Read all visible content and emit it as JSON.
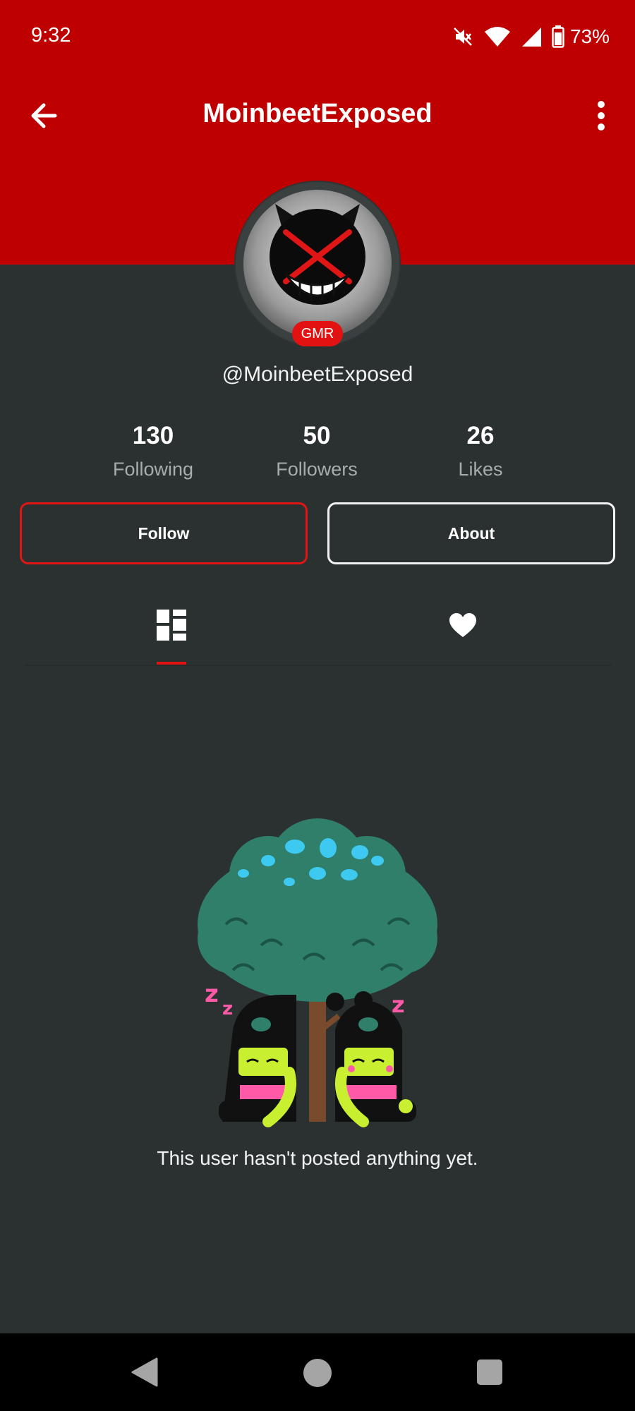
{
  "status_bar": {
    "time": "9:32",
    "battery_percent": "73%",
    "icons": [
      "mute-icon",
      "wifi-icon",
      "signal-icon",
      "battery-icon"
    ]
  },
  "toolbar": {
    "title": "MoinbeetExposed",
    "back_icon": "arrow-left-icon",
    "menu_icon": "more-vertical-icon"
  },
  "profile": {
    "badge": "GMR",
    "username": "@MoinbeetExposed"
  },
  "stats": [
    {
      "value": "130",
      "label": "Following"
    },
    {
      "value": "50",
      "label": "Followers"
    },
    {
      "value": "26",
      "label": "Likes"
    }
  ],
  "actions": {
    "follow_label": "Follow",
    "about_label": "About"
  },
  "tabs": [
    {
      "icon": "grid-icon",
      "selected": true
    },
    {
      "icon": "heart-icon",
      "selected": false
    }
  ],
  "empty_state": {
    "message": "This user hasn't posted anything yet."
  },
  "colors": {
    "header": "#bf0000",
    "background": "#2b3131",
    "accent": "#e31212"
  }
}
